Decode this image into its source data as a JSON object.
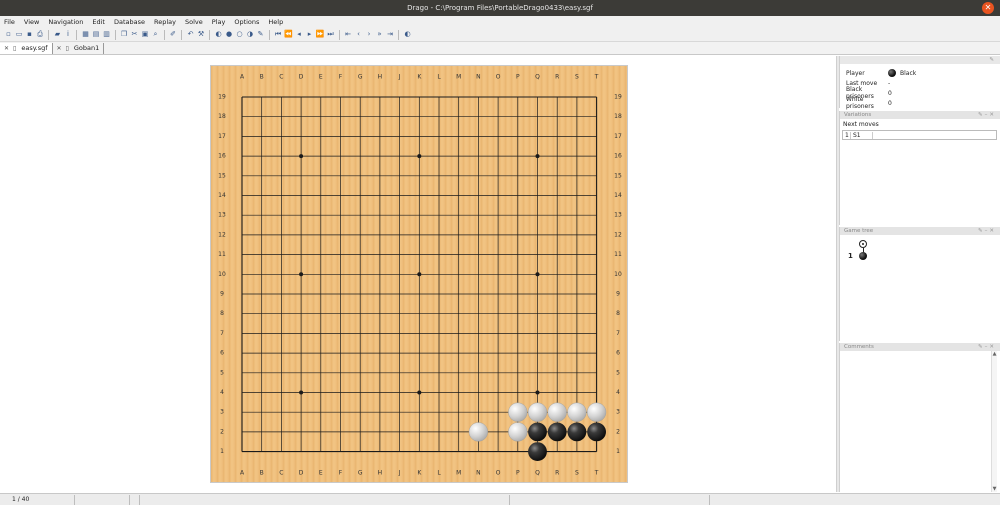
{
  "window": {
    "title": "Drago - C:\\Program Files\\PortableDrago0433\\easy.sgf"
  },
  "menu": [
    "File",
    "View",
    "Navigation",
    "Edit",
    "Database",
    "Replay",
    "Solve",
    "Play",
    "Options",
    "Help"
  ],
  "toolbar_icons": [
    "new-icon",
    "open-icon",
    "save-icon",
    "print-icon",
    "sep",
    "folder-icon",
    "info-icon",
    "sep",
    "grid-icon",
    "grid2-icon",
    "grid3-icon",
    "sep",
    "copy-icon",
    "cut-icon",
    "paste-icon",
    "find-icon",
    "sep",
    "edit-icon",
    "sep",
    "undo-icon",
    "tool-icon",
    "sep",
    "color-icon",
    "black-stone-icon",
    "white-stone-icon",
    "mark-icon",
    "pencil-icon",
    "sep",
    "first-icon",
    "prev-fast-icon",
    "prev-icon",
    "next-icon",
    "next-fast-icon",
    "last-icon",
    "sep",
    "start-icon",
    "back-icon",
    "play-icon",
    "fwd-icon",
    "end-icon",
    "sep",
    "moon-icon"
  ],
  "tabs": [
    {
      "label": "easy.sgf"
    },
    {
      "label": "Goban1"
    }
  ],
  "board": {
    "columns": [
      "A",
      "B",
      "C",
      "D",
      "E",
      "F",
      "G",
      "H",
      "J",
      "K",
      "L",
      "M",
      "N",
      "O",
      "P",
      "Q",
      "R",
      "S",
      "T"
    ],
    "rows": [
      "19",
      "18",
      "17",
      "16",
      "15",
      "14",
      "13",
      "12",
      "11",
      "10",
      "9",
      "8",
      "7",
      "6",
      "5",
      "4",
      "3",
      "2",
      "1"
    ],
    "black_stones": [
      "Q2",
      "R2",
      "S2",
      "T2",
      "Q1"
    ],
    "white_stones": [
      "P3",
      "Q3",
      "R3",
      "S3",
      "T3",
      "N2",
      "P2"
    ],
    "hoshi": [
      "D16",
      "K16",
      "Q16",
      "D10",
      "K10",
      "Q10",
      "D4",
      "K4",
      "Q4"
    ]
  },
  "info_panel": {
    "player_label": "Player",
    "player_value": "Black",
    "last_move_label": "Last move",
    "last_move_value": "-",
    "black_prisoners_label": "Black prisoners",
    "black_prisoners_value": "0",
    "white_prisoners_label": "White prisoners",
    "white_prisoners_value": "0"
  },
  "variations_panel": {
    "title": "Variations",
    "next_moves_label": "Next moves",
    "rows": [
      {
        "num": "1",
        "move": "S1"
      }
    ]
  },
  "game_tree_panel": {
    "title": "Game tree",
    "move_num": "1"
  },
  "comments_panel": {
    "title": "Comments"
  },
  "status": {
    "move_counter": "1 / 40"
  }
}
